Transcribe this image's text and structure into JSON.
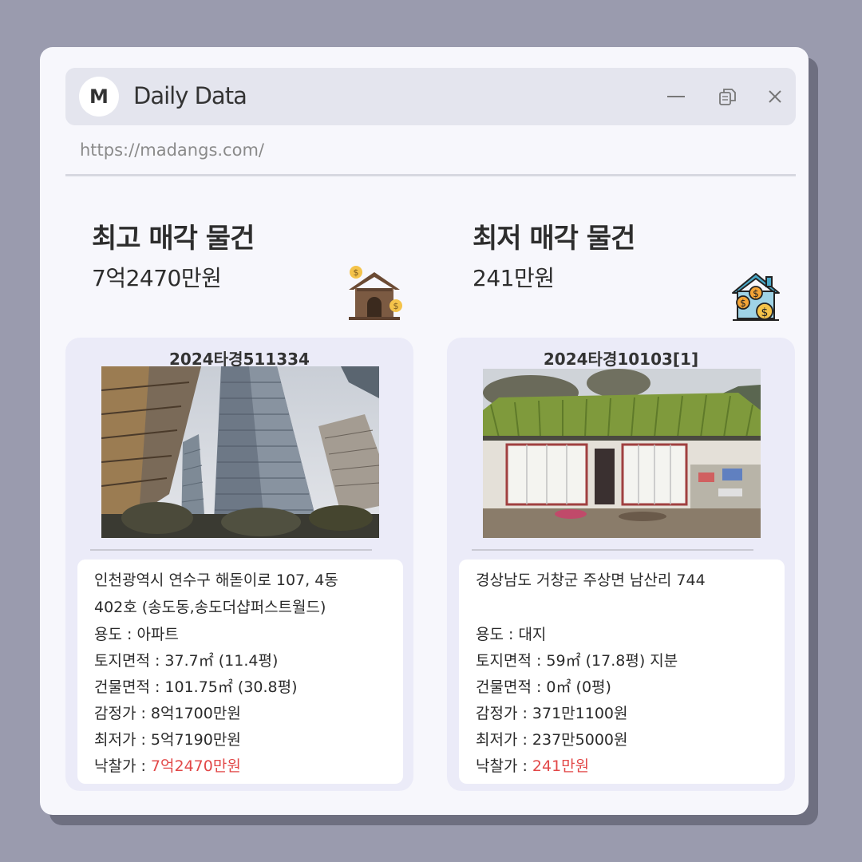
{
  "window": {
    "logo_letter": "M",
    "title": "Daily Data",
    "url": "https://madangs.com/",
    "controls": [
      "minimize-icon",
      "restore-icon",
      "close-icon"
    ]
  },
  "highest": {
    "heading": "최고 매각 물건",
    "price": "7억2470만원",
    "icon": "house-money-icon",
    "case_no": "2024타경511334",
    "photo": "high-rise-apartment-photo",
    "address_line1": "인천광역시 연수구 해돋이로 107, 4동",
    "address_line2": "402호 (송도동,송도더샵퍼스트월드)",
    "usage": "용도 : 아파트",
    "land_area": "토지면적 : 37.7㎡ (11.4평)",
    "building_area": "건물면적 : 101.75㎡ (30.8평)",
    "appraisal": "감정가 : 8억1700만원",
    "minimum": "최저가 : 5억7190만원",
    "sold_label": "낙찰가 : ",
    "sold_value": "7억2470만원"
  },
  "lowest": {
    "heading": "최저 매각 물건",
    "price": "241만원",
    "icon": "house-coins-icon",
    "case_no": "2024타경10103[1]",
    "photo": "old-tile-roof-house-photo",
    "address_line1": "경상남도 거창군 주상면 남산리 744",
    "usage": "용도 : 대지",
    "land_area": "토지면적 : 59㎡ (17.8평) 지분",
    "building_area": "건물면적 : 0㎡ (0평)",
    "appraisal": "감정가 : 371만1100원",
    "minimum": "최저가 : 237만5000원",
    "sold_label": "낙찰가 : ",
    "sold_value": "241만원"
  },
  "colors": {
    "background": "#9a9bae",
    "window": "#f7f7fc",
    "titlebar": "#e4e5ee",
    "card": "#ebebf8",
    "accent_red": "#e24848"
  }
}
